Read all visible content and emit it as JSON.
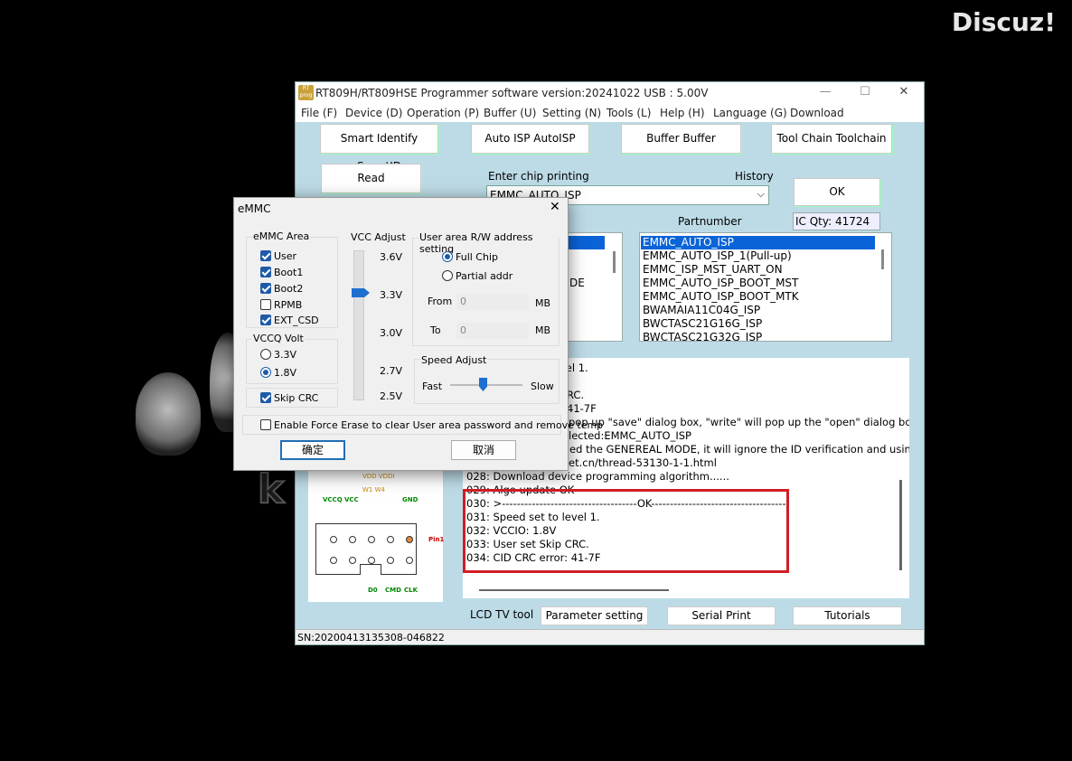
{
  "watermark": "Discuz!",
  "window": {
    "title": "RT809H/RT809HSE Programmer software version:20241022  USB : 5.00V",
    "minimize": "—",
    "maximize": "☐",
    "close": "✕"
  },
  "menu": [
    "File (F)",
    "Device (D)",
    "Operation (P)",
    "Buffer (U)",
    "Setting (N)",
    "Tools (L)",
    "Help (H)",
    "Language (G)",
    "Download"
  ],
  "toolbar": {
    "smartid": "Smart Identify SmartID",
    "autoisp": "Auto ISP AutoISP",
    "buffer": "Buffer Buffer",
    "toolchain": "Tool Chain Toolchain",
    "read": "Read"
  },
  "chip": {
    "enter_label": "Enter chip printing",
    "history_label": "History",
    "value": "EMMC_AUTO_ISP",
    "ok": "OK",
    "partnumber_label": "Partnumber",
    "ic_qty": "IC Qty: 41724"
  },
  "left_list_fragment": "DE",
  "partnumbers": [
    "EMMC_AUTO_ISP",
    "EMMC_AUTO_ISP_1(Pull-up)",
    "EMMC_ISP_MST_UART_ON",
    "EMMC_AUTO_ISP_BOOT_MST",
    "EMMC_AUTO_ISP_BOOT_MTK",
    "BWAMAIA11C04G_ISP",
    "BWCTASC21G16G_ISP",
    "BWCTASC21G32G_ISP"
  ],
  "log_partial": [
    "vel 1.",
    "RC.",
    "41-7F",
    "pop up \"save\" dialog box, \"write\" will pop up the \"open\" dialog box",
    "lected:EMMC_AUTO_ISP",
    "ed the GENEREAL MODE, it will ignore the ID verification and usin",
    "et.cn/thread-53130-1-1.html"
  ],
  "log": [
    "028:  Download device programming algorithm......",
    "029:  Algo update OK",
    "030:  >------------------------------------OK------------------------------------",
    "031:  Speed set to level 1.",
    "032:  VCCIO: 1.8V",
    "033:  User set Skip CRC.",
    "034:  CID CRC error: 41-7F"
  ],
  "diagram": {
    "l1": "VDD   VDDI",
    "l2": "W1    W4",
    "vccq": "VCCQ",
    "vcc": "VCC",
    "gnd": "GND",
    "pin1": "Pin1",
    "d0": "D0",
    "cmd": "CMD",
    "clk": "CLK"
  },
  "bottom": {
    "lcd": "LCD TV tool",
    "param": "Parameter setting",
    "serial": "Serial Print",
    "tutorials": "Tutorials",
    "sn": "SN:20200413135308-046822"
  },
  "dialog": {
    "title": "eMMC",
    "close": "✕",
    "area_label": "eMMC Area",
    "areas": [
      {
        "label": "User",
        "checked": true
      },
      {
        "label": "Boot1",
        "checked": true
      },
      {
        "label": "Boot2",
        "checked": true
      },
      {
        "label": "RPMB",
        "checked": false
      },
      {
        "label": "EXT_CSD",
        "checked": true
      }
    ],
    "vccq_label": "VCCQ Volt",
    "vccq_33": "3.3V",
    "vccq_18": "1.8V",
    "vccq_selected": "1.8V",
    "skip_crc": "Skip CRC",
    "vcc_label": "VCC Adjust",
    "vcc_ticks": [
      "3.6V",
      "3.3V",
      "3.0V",
      "2.7V",
      "2.5V"
    ],
    "vcc_value": "3.3V",
    "rw_label": "User area R/W address setting",
    "full_chip": "Full Chip",
    "partial": "Partial addr",
    "from_label": "From",
    "from_value": "0",
    "to_label": "To",
    "to_value": "0",
    "mb": "MB",
    "speed_label": "Speed Adjust",
    "fast": "Fast",
    "slow": "Slow",
    "speed_level": 0.45,
    "force_erase": "Enable Force Erase to clear User area password and remove temp",
    "ok": "确定",
    "cancel": "取消"
  }
}
